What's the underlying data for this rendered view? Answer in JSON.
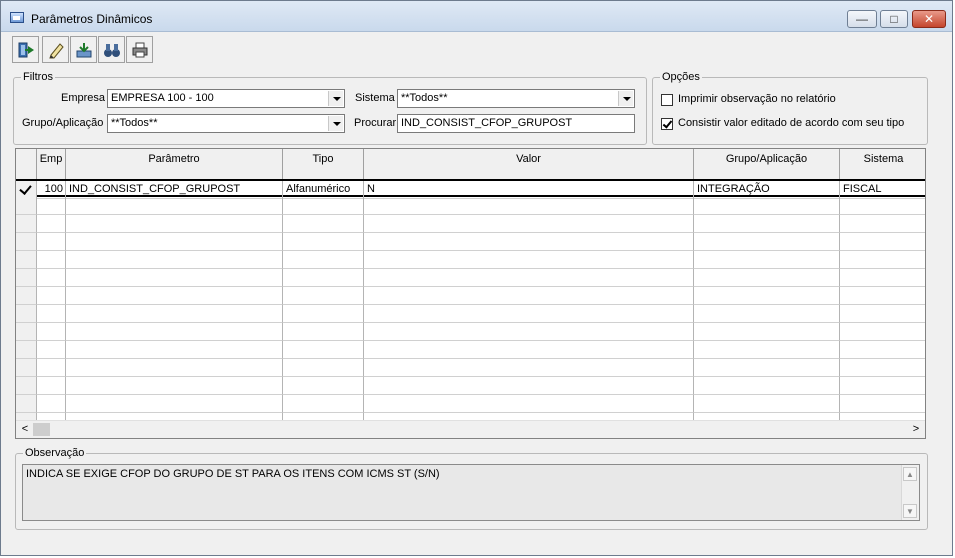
{
  "window": {
    "title": "Parâmetros Dinâmicos",
    "controls": {
      "minimize": "—",
      "maximize": "□",
      "close": "✕"
    }
  },
  "toolbar": {
    "buttons": [
      {
        "name": "exit-icon"
      },
      {
        "name": "edit-pencil-icon"
      },
      {
        "name": "save-download-icon"
      },
      {
        "name": "binoculars-search-icon"
      },
      {
        "name": "printer-icon"
      }
    ]
  },
  "filters": {
    "legend": "Filtros",
    "empresa_label": "Empresa",
    "empresa_value": "EMPRESA 100 - 100",
    "sistema_label": "Sistema",
    "sistema_value": "**Todos**",
    "grupo_label": "Grupo/Aplicação",
    "grupo_value": "**Todos**",
    "procurar_label": "Procurar",
    "procurar_value": "IND_CONSIST_CFOP_GRUPOST"
  },
  "options": {
    "legend": "Opções",
    "opt1_label": "Imprimir observação no relatório",
    "opt1_checked": false,
    "opt2_label": "Consistir valor editado de acordo com seu tipo",
    "opt2_checked": true
  },
  "grid": {
    "columns": [
      "Emp",
      "Parâmetro",
      "Tipo",
      "Valor",
      "Grupo/Aplicação",
      "Sistema"
    ],
    "rows": [
      {
        "emp": "100",
        "parametro": "IND_CONSIST_CFOP_GRUPOST",
        "tipo": "Alfanumérico",
        "valor": "N",
        "grupo": "INTEGRAÇÃO",
        "sistema": "FISCAL"
      }
    ],
    "scroll_left": "<",
    "scroll_right": ">"
  },
  "observacao": {
    "legend": "Observação",
    "text": "INDICA SE EXIGE CFOP DO GRUPO DE ST PARA OS ITENS COM ICMS ST (S/N)",
    "scroll_up": "▲",
    "scroll_down": "▼"
  }
}
